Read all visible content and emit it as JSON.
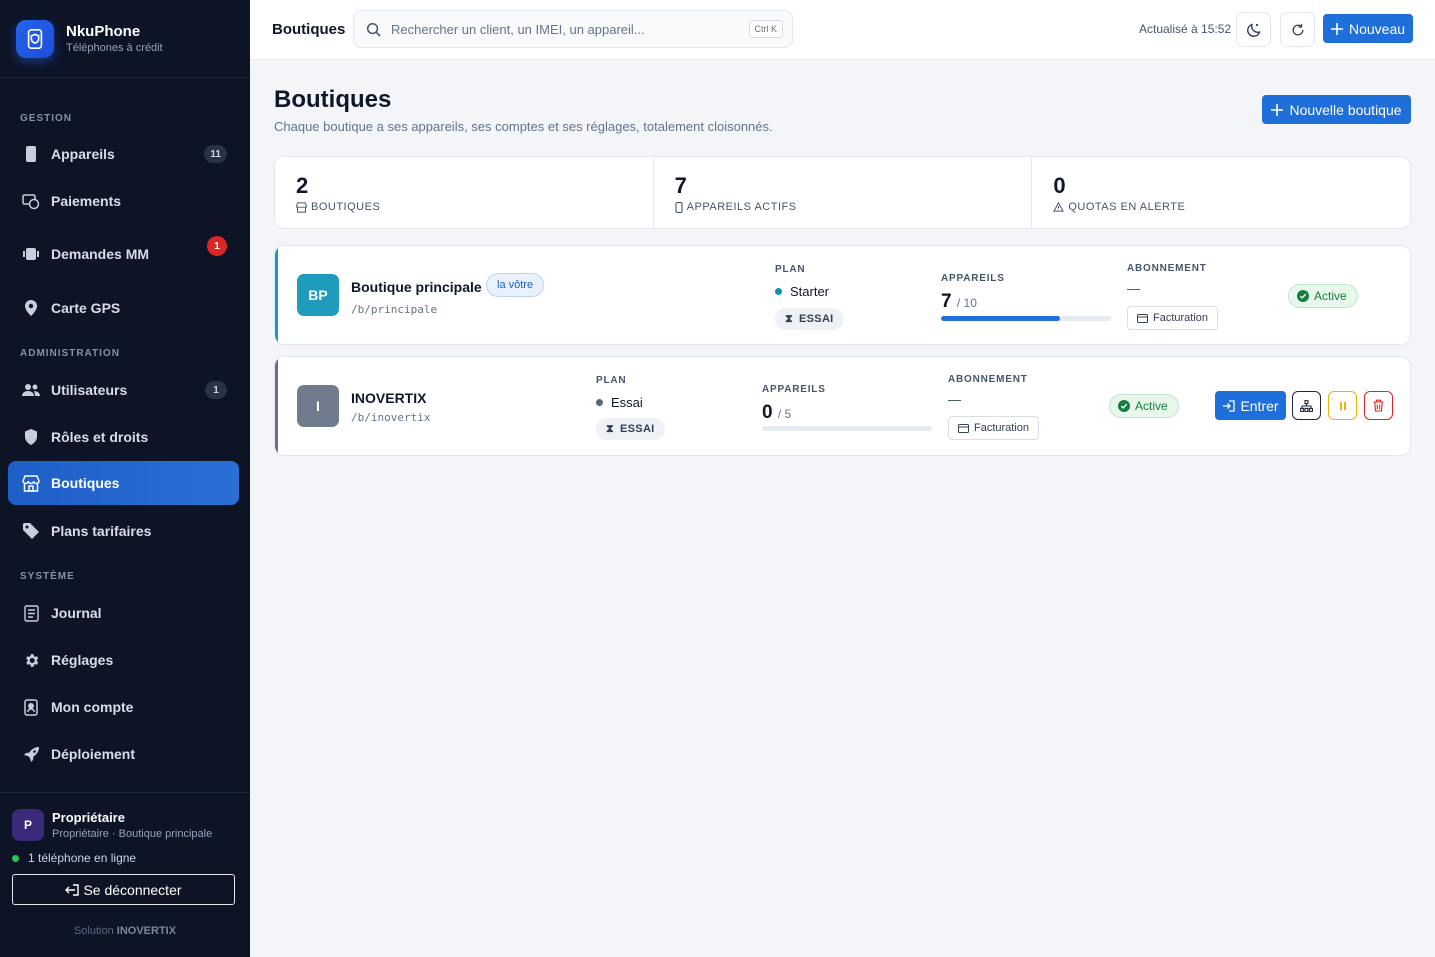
{
  "brand": {
    "name": "NkuPhone",
    "tagline": "Téléphones à crédit"
  },
  "sidebar": {
    "sections": {
      "gestion": "GESTION",
      "administration": "ADMINISTRATION",
      "systeme": "SYSTÈME"
    },
    "items": [
      {
        "label": "Appareils",
        "icon": "phone-icon",
        "badge": "11"
      },
      {
        "label": "Paiements",
        "icon": "payments-icon"
      },
      {
        "label": "Demandes MM",
        "icon": "money-icon",
        "badge": "1",
        "badge_color": "#dc2626"
      },
      {
        "label": "Carte GPS",
        "icon": "map-pin-icon"
      },
      {
        "label": "Utilisateurs",
        "icon": "users-icon",
        "badge": "1"
      },
      {
        "label": "Rôles et droits",
        "icon": "shield-icon"
      },
      {
        "label": "Boutiques",
        "icon": "store-icon",
        "active": true
      },
      {
        "label": "Plans tarifaires",
        "icon": "tag-icon"
      },
      {
        "label": "Journal",
        "icon": "journal-icon"
      },
      {
        "label": "Réglages",
        "icon": "gear-icon"
      },
      {
        "label": "Mon compte",
        "icon": "account-icon"
      },
      {
        "label": "Déploiement",
        "icon": "rocket-icon"
      }
    ],
    "user": {
      "initial": "P",
      "name": "Propriétaire",
      "role": "Propriétaire · Boutique principale"
    },
    "online": "1 téléphone en ligne",
    "logout": "Se déconnecter",
    "credit_prefix": "Solution",
    "credit_brand": "INOVERTIX"
  },
  "topbar": {
    "title": "Boutiques",
    "search_placeholder": "Rechercher un client, un IMEI, un appareil...",
    "shortcut": "Ctrl K",
    "refreshed": "Actualisé à 15:52",
    "new_button": "Nouveau"
  },
  "page": {
    "title": "Boutiques",
    "subtitle": "Chaque boutique a ses appareils, ses comptes et ses réglages, totalement cloisonnés.",
    "new_shop_button": "Nouvelle boutique"
  },
  "stats": [
    {
      "value": "2",
      "label": "BOUTIQUES",
      "icon": "store-icon"
    },
    {
      "value": "7",
      "label": "APPAREILS ACTIFS",
      "icon": "phone-icon"
    },
    {
      "value": "0",
      "label": "QUOTAS EN ALERTE",
      "icon": "warning-icon"
    }
  ],
  "labels": {
    "plan": "PLAN",
    "devices": "APPAREILS",
    "subscription": "ABONNEMENT",
    "billing": "Facturation",
    "enter": "Entrer"
  },
  "shops": [
    {
      "initials": "BP",
      "name": "Boutique principale",
      "tag": "la vôtre",
      "slug": "/b/principale",
      "plan": "Starter",
      "plan_dot": "#0e8fb4",
      "trial": "ESSAI",
      "devices_used": "7",
      "devices_max": "/ 10",
      "usage_fraction": 0.7,
      "subscription": "—",
      "status": "Active",
      "accent": "#1a9bb8",
      "avatar_color": "#1f9bbb"
    },
    {
      "initials": "I",
      "name": "INOVERTIX",
      "slug": "/b/inovertix",
      "plan": "Essai",
      "plan_dot": "#5b6478",
      "trial": "ESSAI",
      "devices_used": "0",
      "devices_max": "/ 5",
      "usage_fraction": 0,
      "subscription": "—",
      "status": "Active",
      "accent": "#6b7280",
      "avatar_color": "#717b8e"
    }
  ]
}
